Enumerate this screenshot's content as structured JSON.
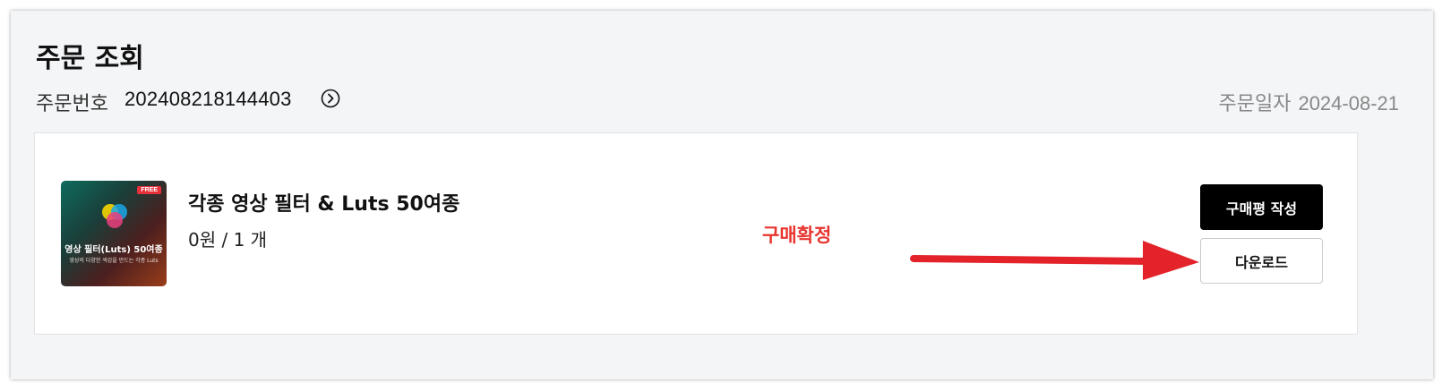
{
  "header": {
    "title": "주문 조회",
    "order_label": "주문번호",
    "order_number": "202408218144403",
    "order_date_label": "주문일자",
    "order_date": "2024-08-21"
  },
  "item": {
    "title": "각종 영상 필터 & Luts 50여종",
    "price_qty": "0원 / 1 개",
    "status": "구매확정",
    "thumbnail": {
      "badge": "FREE",
      "title": "영상 필터(Luts) 50여종",
      "subtitle": "영상의 다양한 색감을 만드는 각종 Luts"
    },
    "actions": {
      "review_label": "구매평 작성",
      "download_label": "다운로드"
    }
  },
  "colors": {
    "panel_bg": "#f4f5f7",
    "status_red": "#e8342f",
    "annotation_arrow": "#e3222a",
    "primary_button": "#000000"
  },
  "icons": {
    "order_detail": "chevron-right-circle-icon",
    "annotation": "red-arrow-icon"
  }
}
